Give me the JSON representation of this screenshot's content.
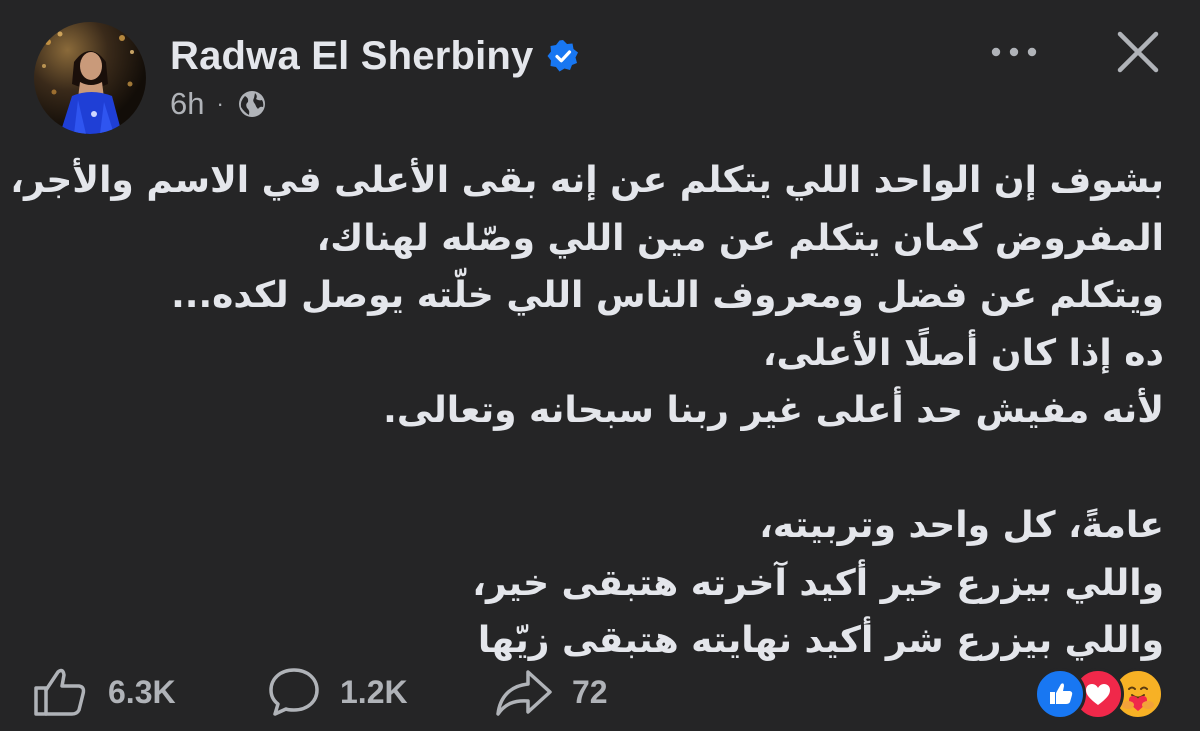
{
  "post": {
    "author": {
      "name": "Radwa El Sherbiny",
      "verified": true
    },
    "meta": {
      "time": "6h",
      "separator": "·",
      "audience_icon": "globe-icon"
    },
    "header_buttons": {
      "more_icon": "more-dots-icon",
      "close_icon": "close-icon"
    },
    "text_lines": [
      "بشوف إن الواحد اللي يتكلم عن إنه بقى الأعلى في الاسم والأجر،",
      "المفروض كمان يتكلم عن مين اللي وصّله لهناك،",
      "ويتكلم عن فضل ومعروف الناس اللي خلّته يوصل لكده...",
      "ده إذا كان أصلًا الأعلى،",
      "لأنه مفيش حد أعلى غير ربنا سبحانه وتعالى.",
      "",
      "عامةً، كل واحد وتربيته،",
      "واللي بيزرع خير أكيد آخرته هتبقى خير،",
      "واللي بيزرع شر أكيد نهايته هتبقى زيّها"
    ],
    "actions": {
      "likes": "6.3K",
      "comments": "1.2K",
      "shares": "72"
    },
    "reactions": [
      "like-reaction-icon",
      "love-reaction-icon",
      "care-reaction-icon"
    ],
    "colors": {
      "background": "#252526",
      "text_primary": "#e4e6eb",
      "text_secondary": "#b0b3b8",
      "verified_blue": "#1877f2",
      "like_blue": "#1877f2",
      "love_red": "#f0284a",
      "care_yellow": "#f7b125"
    }
  }
}
